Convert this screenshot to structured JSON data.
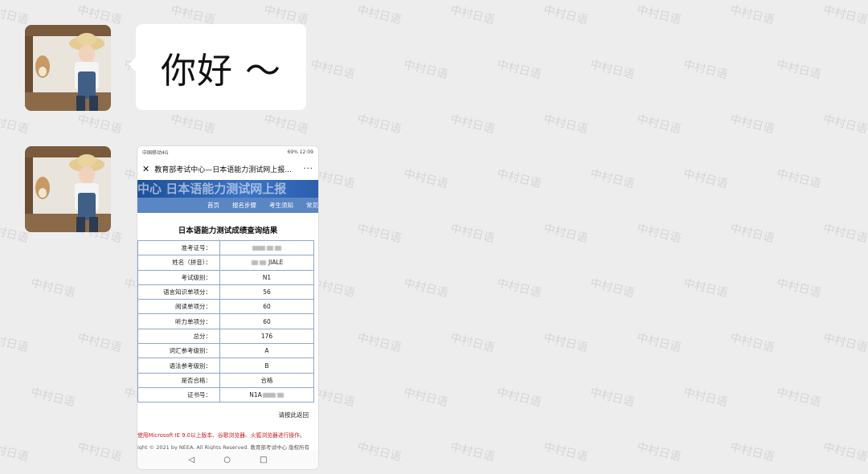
{
  "watermark_text": "中村日语",
  "message_1": {
    "text": "你好 ～"
  },
  "phone": {
    "status_left": "中国移动4G",
    "status_right": "69% 12:09",
    "title": "教育部考试中心—日本语能力测试网上报...",
    "banner_text": "中心 日本语能力测试网上报",
    "nav_items": [
      "首页",
      "报名步骤",
      "考生须知",
      "常见"
    ],
    "result_title": "日本语能力测试成绩查询结果",
    "rows": [
      {
        "label": "准考证号：",
        "value": ""
      },
      {
        "label": "姓名（拼音）：",
        "value": "JIALE"
      },
      {
        "label": "考试级别：",
        "value": "N1"
      },
      {
        "label": "语言知识单项分：",
        "value": "56"
      },
      {
        "label": "阅读单项分：",
        "value": "60"
      },
      {
        "label": "听力单项分：",
        "value": "60"
      },
      {
        "label": "总分：",
        "value": "176"
      },
      {
        "label": "词汇参考级别：",
        "value": "A"
      },
      {
        "label": "语法参考级别：",
        "value": "B"
      },
      {
        "label": "是否合格：",
        "value": "合格"
      },
      {
        "label": "证书号：",
        "value": "N1A"
      }
    ],
    "back_link": "请按此返回",
    "notice": "使用Microsoft IE 9.0以上版本、谷歌浏览器、火狐浏览器进行操作。",
    "copyright": "ight © 2021 by NEEA. All Rights Reserved. 教育部考试中心 版权所有",
    "android_back": "◁",
    "android_home": "○",
    "android_recent": "□"
  }
}
